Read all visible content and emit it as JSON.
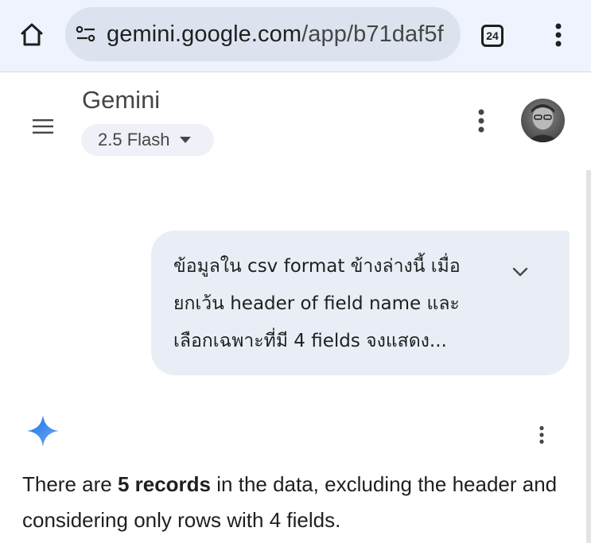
{
  "browser": {
    "url_host": "gemini.google.com",
    "url_path": "/app/b71daf5f",
    "tab_count": "24",
    "icons": {
      "home": "home-icon",
      "site_info": "tune-icon",
      "menu": "more-vert-icon"
    }
  },
  "app": {
    "title": "Gemini",
    "model": "2.5 Flash",
    "icons": {
      "nav": "hamburger-menu-icon",
      "menu": "more-vert-icon",
      "model_dropdown": "caret-down-icon"
    }
  },
  "conversation": {
    "user_message": {
      "lines": [
        "ข้อมูลใน csv format ข้างล่างนี้ เมื่อ",
        "ยกเว้น header of field name และ",
        "เลือกเฉพาะที่มี 4 fields จงแสดง..."
      ],
      "expand_icon": "chevron-down-icon"
    },
    "response": {
      "icon": "gemini-spark-icon",
      "text_before": "There are ",
      "text_bold": "5 records",
      "text_after": " in the data, excluding the header and considering only rows with 4 fields."
    }
  },
  "colors": {
    "browser_bar": "#eef3fd",
    "url_pill": "#dde3ee",
    "user_bubble": "#e9eef6",
    "model_pill": "#eef2f8",
    "spark_blue": "#4285f4"
  }
}
